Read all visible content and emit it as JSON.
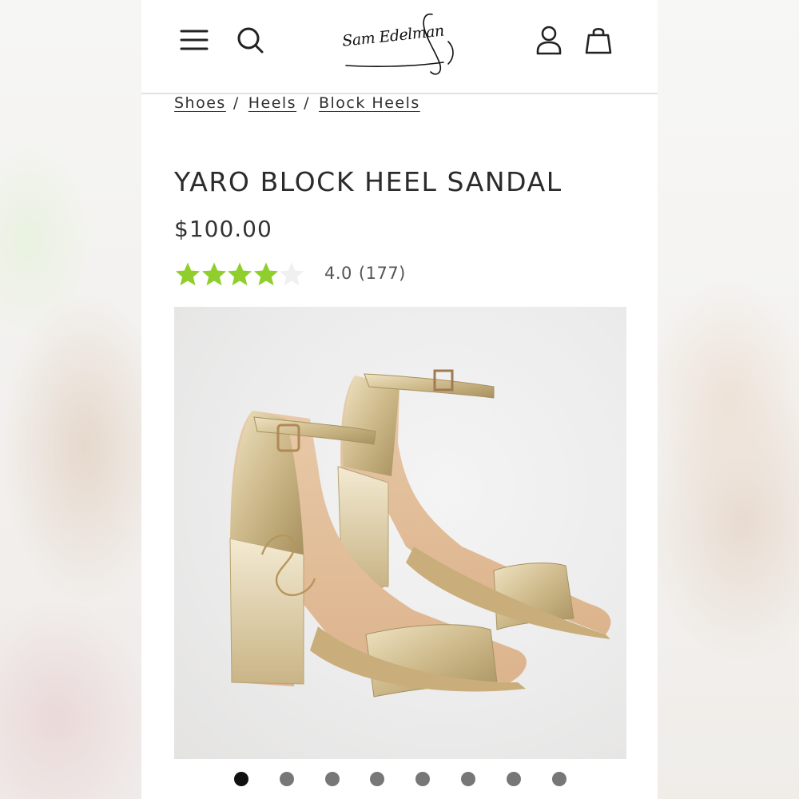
{
  "header": {
    "brand": "Sam Edelman",
    "menu_icon": "hamburger-menu-icon",
    "search_icon": "search-icon",
    "account_icon": "user-account-icon",
    "cart_icon": "shopping-bag-icon"
  },
  "breadcrumb": [
    {
      "label": "Shoes"
    },
    {
      "label": "Heels"
    },
    {
      "label": "Block Heels"
    }
  ],
  "product": {
    "title": "YARO BLOCK HEEL SANDAL",
    "price": "$100.00",
    "rating_value": "4.0",
    "review_count": "(177)",
    "stars_filled": 4,
    "stars_total": 5,
    "star_color": "#8fce2c",
    "star_empty_color": "#f0f0f0"
  },
  "gallery": {
    "total_images": 8,
    "active_index": 0
  }
}
